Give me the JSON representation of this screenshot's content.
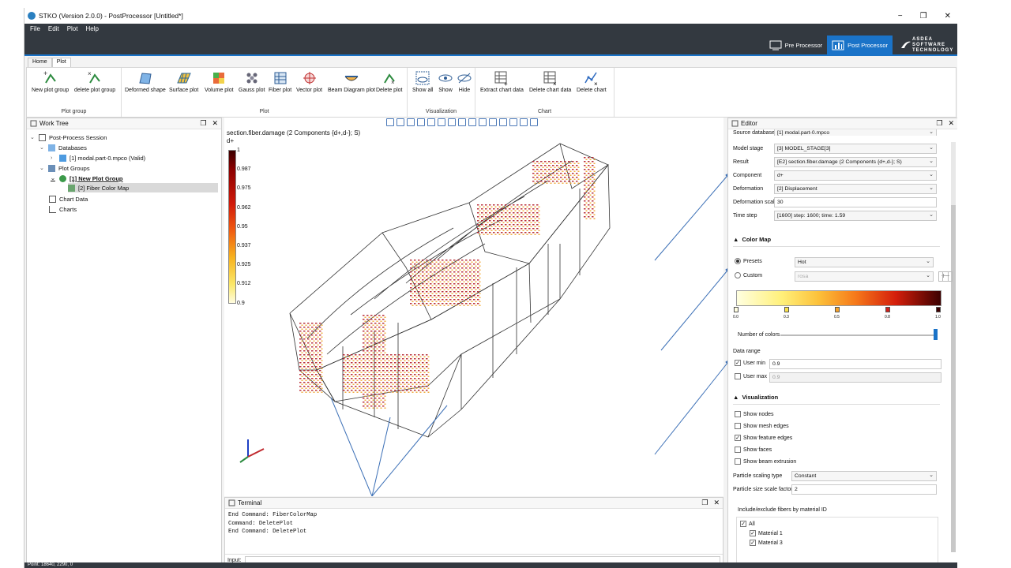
{
  "window": {
    "title": "STKO (Version 2.0.0) - PostProcessor [Untitled*]",
    "minimize": "−",
    "restore": "❐",
    "close": "✕"
  },
  "menu": [
    "File",
    "Edit",
    "Plot",
    "Help"
  ],
  "switcher": {
    "pre": "Pre Processor",
    "post": "Post Processor",
    "brand": "ASDEA SOFTWARE TECHNOLOGY"
  },
  "ribbon_tabs": [
    "Home",
    "Plot"
  ],
  "ribbon": {
    "plot_group": {
      "label": "Plot group",
      "new": "New plot group",
      "delete": "delete plot group"
    },
    "plot": {
      "label": "Plot",
      "buttons": [
        "Deformed shape",
        "Surface plot",
        "Volume plot",
        "Gauss plot",
        "Fiber plot",
        "Vector plot",
        "Beam Diagram plot",
        "Delete plot"
      ]
    },
    "visualization": {
      "label": "Visualization",
      "buttons": [
        "Show all",
        "Show",
        "Hide"
      ]
    },
    "chart": {
      "label": "Chart",
      "buttons": [
        "Extract chart data",
        "Delete chart data",
        "Delete chart"
      ]
    }
  },
  "work_tree": {
    "title": "Work Tree",
    "items": [
      "Post-Process Session",
      "Databases",
      "[1] modal.part-0.mpco (Valid)",
      "Plot Groups",
      "[1] New Plot Group",
      "[2] Fiber Color Map",
      "Chart Data",
      "Charts"
    ]
  },
  "viewport": {
    "legend_title": "section.fiber.damage (2 Components {d+,d-}; S)",
    "legend_component": "d+",
    "legend_ticks": [
      "1",
      "0.987",
      "0.975",
      "0.962",
      "0.95",
      "0.937",
      "0.925",
      "0.912",
      "0.9"
    ]
  },
  "terminal": {
    "title": "Terminal",
    "lines": [
      "End Command: FiberColorMap",
      "Command: DeletePlot",
      "End Command: DeletePlot"
    ],
    "input_label": "Input:"
  },
  "editor": {
    "title": "Editor",
    "source_label": "Source database",
    "source_value": "[1] modal.part-0.mpco",
    "rows": [
      {
        "label": "Model stage",
        "value": "[3] MODEL_STAGE[3]"
      },
      {
        "label": "Result",
        "value": "[E2] section.fiber.damage (2 Components {d+,d-}; S)"
      },
      {
        "label": "Component",
        "value": "d+"
      },
      {
        "label": "Deformation",
        "value": "[2] Displacement"
      },
      {
        "label": "Deformation scale",
        "value": "30"
      },
      {
        "label": "Time step",
        "value": "[1600] step: 1600; time: 1.59"
      }
    ],
    "color_map": {
      "title": "Color Map",
      "presets_label": "Presets",
      "presets_value": "Hot",
      "custom_label": "Custom",
      "custom_value": "rosa",
      "stop_labels": [
        "0.0",
        "0.3",
        "0.5",
        "0.8",
        "1.0"
      ],
      "number_of_colors": "Number of colors",
      "data_range": "Data range",
      "user_min_label": "User min",
      "user_min_value": "0.9",
      "user_max_label": "User max",
      "user_max_value": "0.9"
    },
    "visualization": {
      "title": "Visualization",
      "checks": [
        {
          "label": "Show nodes",
          "checked": false
        },
        {
          "label": "Show mesh edges",
          "checked": false
        },
        {
          "label": "Show feature edges",
          "checked": true
        },
        {
          "label": "Show faces",
          "checked": false
        },
        {
          "label": "Show beam extrusion",
          "checked": false
        }
      ],
      "particle_scaling_label": "Particle scaling type",
      "particle_scaling_value": "Constant",
      "particle_size_label": "Particle size scale factor",
      "particle_size_value": "2",
      "fibers_title": "Include/exclude fibers by material ID",
      "fibers": [
        "All",
        "Material 1",
        "Material 3"
      ]
    }
  },
  "status": "Point: 18640, 2290, 0",
  "colors": {
    "accent": "#1a73c8",
    "dark": "#333940",
    "arrow": "#3b6fb6"
  }
}
